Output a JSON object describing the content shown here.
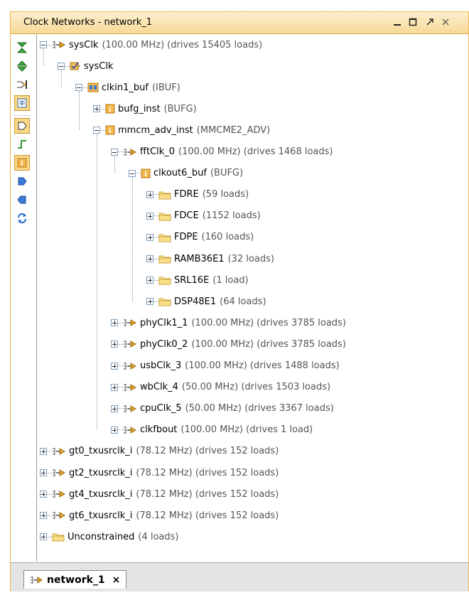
{
  "window": {
    "title": "Clock Networks - network_1",
    "controls": {
      "minimize": "_",
      "maximize": "□",
      "restore": "↗",
      "close": "×"
    }
  },
  "tab": {
    "label": "network_1",
    "close": "×"
  },
  "tree": [
    {
      "level": 0,
      "expander": "minus",
      "icon": "clock-net-icon",
      "name": "sysClk",
      "info": "(100.00 MHz) (drives 15405 loads)"
    },
    {
      "level": 1,
      "expander": "minus",
      "icon": "port-check-icon",
      "name": "sysClk",
      "info": ""
    },
    {
      "level": 2,
      "expander": "minus",
      "icon": "buffer-cell-icon",
      "name": "clkin1_buf",
      "info": "(IBUF)"
    },
    {
      "level": 3,
      "expander": "plus",
      "icon": "cell-icon",
      "name": "bufg_inst",
      "info": "(BUFG)"
    },
    {
      "level": 3,
      "expander": "minus",
      "icon": "cell-icon",
      "name": "mmcm_adv_inst",
      "info": "(MMCME2_ADV)"
    },
    {
      "level": 4,
      "expander": "minus",
      "icon": "clock-net-icon",
      "name": "fftClk_0",
      "info": "(100.00 MHz) (drives 1468 loads)"
    },
    {
      "level": 5,
      "expander": "minus",
      "icon": "cell-icon",
      "name": "clkout6_buf",
      "info": "(BUFG)"
    },
    {
      "level": 6,
      "expander": "plus",
      "icon": "folder-icon",
      "name": "FDRE",
      "info": "(59 loads)"
    },
    {
      "level": 6,
      "expander": "plus",
      "icon": "folder-icon",
      "name": "FDCE",
      "info": "(1152 loads)"
    },
    {
      "level": 6,
      "expander": "plus",
      "icon": "folder-icon",
      "name": "FDPE",
      "info": "(160 loads)"
    },
    {
      "level": 6,
      "expander": "plus",
      "icon": "folder-icon",
      "name": "RAMB36E1",
      "info": "(32 loads)"
    },
    {
      "level": 6,
      "expander": "plus",
      "icon": "folder-icon",
      "name": "SRL16E",
      "info": "(1 load)"
    },
    {
      "level": 6,
      "expander": "plus",
      "icon": "folder-icon",
      "name": "DSP48E1",
      "info": "(64 loads)"
    },
    {
      "level": 4,
      "expander": "plus",
      "icon": "clock-net-icon",
      "name": "phyClk1_1",
      "info": "(100.00 MHz) (drives 3785 loads)"
    },
    {
      "level": 4,
      "expander": "plus",
      "icon": "clock-net-icon",
      "name": "phyClk0_2",
      "info": "(100.00 MHz) (drives 3785 loads)"
    },
    {
      "level": 4,
      "expander": "plus",
      "icon": "clock-net-icon",
      "name": "usbClk_3",
      "info": "(100.00 MHz) (drives 1488 loads)"
    },
    {
      "level": 4,
      "expander": "plus",
      "icon": "clock-net-icon",
      "name": "wbClk_4",
      "info": "(50.00 MHz) (drives 1503 loads)"
    },
    {
      "level": 4,
      "expander": "plus",
      "icon": "clock-net-icon",
      "name": "cpuClk_5",
      "info": "(50.00 MHz) (drives 3367 loads)"
    },
    {
      "level": 4,
      "expander": "plus",
      "icon": "clock-net-icon",
      "name": "clkfbout",
      "info": "(100.00 MHz) (drives 1 load)"
    },
    {
      "level": 0,
      "expander": "plus",
      "icon": "clock-net-icon",
      "name": "gt0_txusrclk_i",
      "info": "(78.12 MHz) (drives 152 loads)"
    },
    {
      "level": 0,
      "expander": "plus",
      "icon": "clock-net-icon",
      "name": "gt2_txusrclk_i",
      "info": "(78.12 MHz) (drives 152 loads)"
    },
    {
      "level": 0,
      "expander": "plus",
      "icon": "clock-net-icon",
      "name": "gt4_txusrclk_i",
      "info": "(78.12 MHz) (drives 152 loads)"
    },
    {
      "level": 0,
      "expander": "plus",
      "icon": "clock-net-icon",
      "name": "gt6_txusrclk_i",
      "info": "(78.12 MHz) (drives 152 loads)"
    },
    {
      "level": 0,
      "expander": "plus",
      "icon": "folder-icon",
      "name": "Unconstrained",
      "info": "(4 loads)"
    }
  ],
  "colors": {
    "title_bar": "#f6d996",
    "border": "#f0b54a",
    "selected_tool": "#f9d989"
  }
}
